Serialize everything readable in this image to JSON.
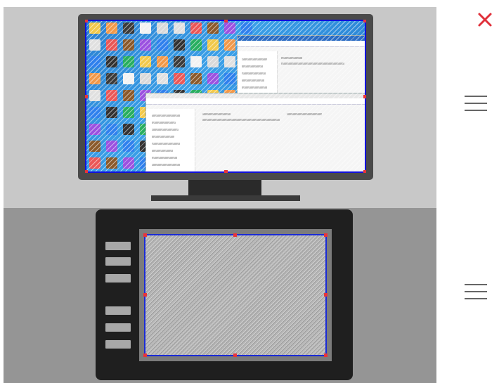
{
  "colors": {
    "monitor_background": "#c8c8c8",
    "tablet_background": "#959595",
    "mapping_border": "#1a2bd6",
    "handle": "#e8343a",
    "close": "#e0303a"
  },
  "sidebar": {
    "close_icon": "close-icon",
    "drag_icons": [
      "drag-handle-icon",
      "drag-handle-icon"
    ]
  },
  "monitor": {
    "desktop_icon_colors": [
      "#f2c94c",
      "#8b5a2b",
      "#3b3b3b",
      "#2f80ed",
      "#d9d9d9",
      "#27ae60",
      "#eb5757",
      "#f2994a",
      "#9b51e0",
      "#f2f2f2",
      "#333333",
      "#e0e0e0"
    ]
  },
  "tablet": {
    "express_keys": 6
  }
}
